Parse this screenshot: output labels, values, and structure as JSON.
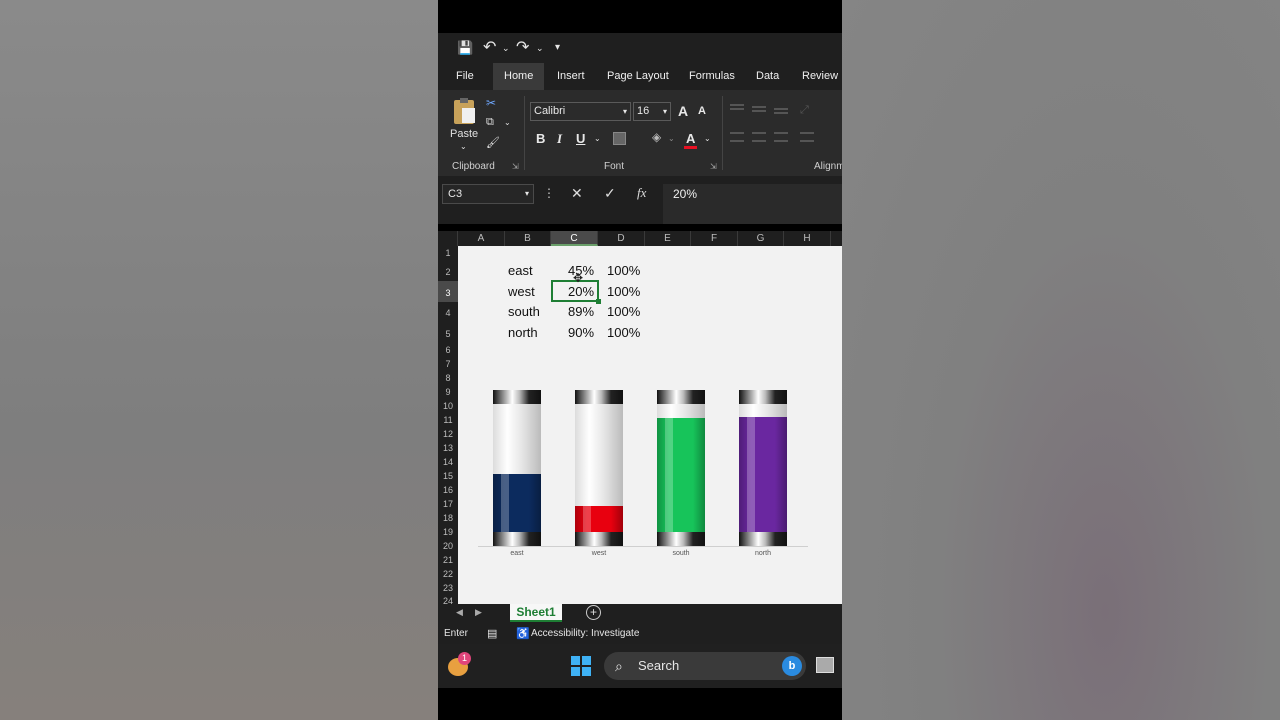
{
  "quick_access": {
    "save": "💾",
    "undo": "↶",
    "redo": "↷",
    "more": "▾"
  },
  "tabs": [
    "File",
    "Home",
    "Insert",
    "Page Layout",
    "Formulas",
    "Data",
    "Review"
  ],
  "active_tab": "Home",
  "ribbon": {
    "paste_label": "Paste",
    "clipboard_label": "Clipboard",
    "font_group_label": "Font",
    "alignment_label": "Alignm",
    "font_name": "Calibri",
    "font_size": "16",
    "bold": "B",
    "italic": "I",
    "underline": "U",
    "grow_font": "A",
    "shrink_font": "A",
    "font_color": "A",
    "font_color_hex": "#e81123"
  },
  "formula_bar": {
    "name_box": "C3",
    "cancel": "✕",
    "enter": "✓",
    "fx": "fx",
    "value": "20%"
  },
  "columns": [
    "A",
    "B",
    "C",
    "D",
    "E",
    "F",
    "G",
    "H"
  ],
  "selected_column": "C",
  "rows": [
    "1",
    "2",
    "3",
    "4",
    "5",
    "6",
    "7",
    "8",
    "9",
    "10",
    "11",
    "12",
    "13",
    "14",
    "15",
    "16",
    "17",
    "18",
    "19",
    "20",
    "21",
    "22",
    "23",
    "24"
  ],
  "selected_row": "3",
  "table": [
    {
      "region": "east",
      "value": "45%",
      "max": "100%"
    },
    {
      "region": "west",
      "value": "20%",
      "max": "100%"
    },
    {
      "region": "south",
      "value": "89%",
      "max": "100%"
    },
    {
      "region": "north",
      "value": "90%",
      "max": "100%"
    }
  ],
  "chart_data": {
    "type": "bar",
    "categories": [
      "east",
      "west",
      "south",
      "north"
    ],
    "series": [
      {
        "values": [
          0.45,
          0.2,
          0.89,
          0.9
        ]
      },
      {
        "values": [
          1,
          1,
          1,
          1
        ]
      }
    ],
    "colors": [
      "#0c2b5e",
      "#e8000f",
      "#17c45a",
      "#6a27a0"
    ],
    "ylim": [
      0,
      1
    ],
    "grid": false
  },
  "sheet_tab": "Sheet1",
  "status": {
    "mode": "Enter",
    "accessibility": "Accessibility: Investigate"
  },
  "taskbar": {
    "search_placeholder": "Search",
    "weather_badge": "1"
  }
}
